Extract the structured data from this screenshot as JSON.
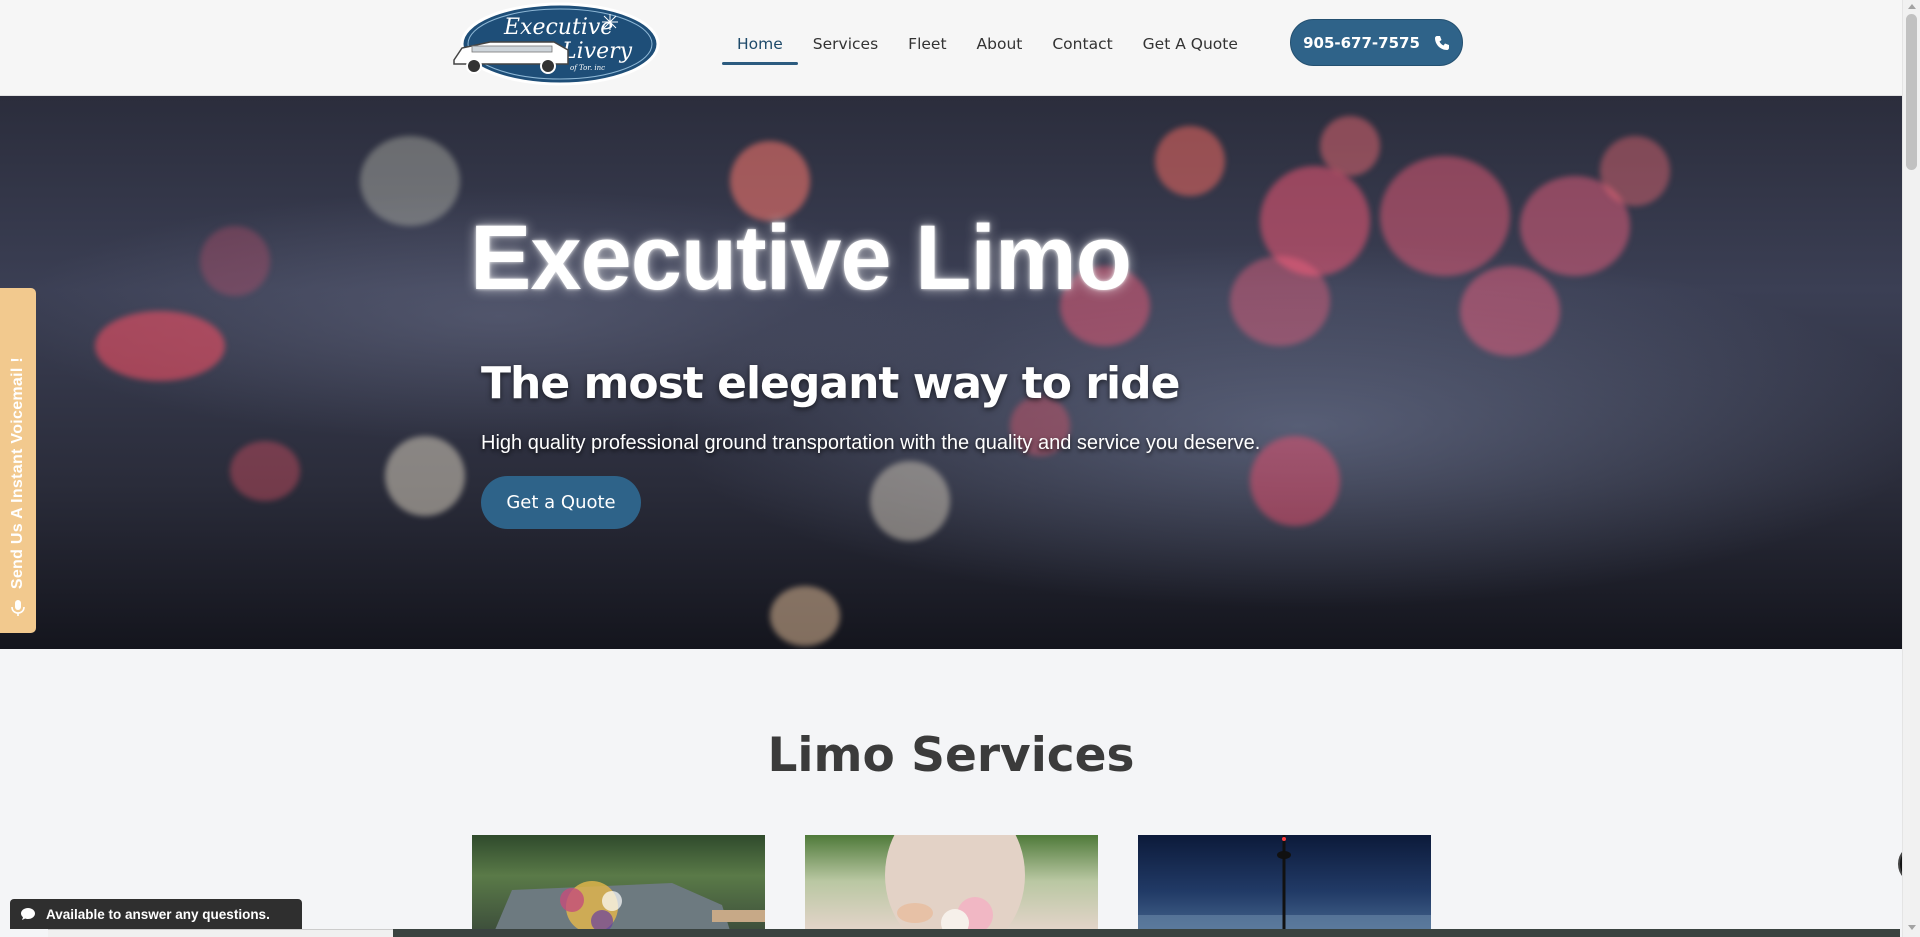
{
  "header": {
    "logo_alt": "Executive Livery",
    "logo_line1": "Executive",
    "logo_line2": "Livery",
    "logo_line3": "of Tor. inc",
    "nav": [
      {
        "label": "Home",
        "active": true
      },
      {
        "label": "Services",
        "active": false
      },
      {
        "label": "Fleet",
        "active": false
      },
      {
        "label": "About",
        "active": false
      },
      {
        "label": "Contact",
        "active": false
      },
      {
        "label": "Get A Quote",
        "active": false
      }
    ],
    "phone": "905-677-7575",
    "phone_icon": "phone-icon"
  },
  "hero": {
    "title": "Executive Limo",
    "subtitle": "The most elegant way to ride",
    "description": "High quality professional ground transportation with the quality and service you deserve.",
    "cta_label": "Get a Quote"
  },
  "voicemail": {
    "label": "Send Us A Instant Voicemail !",
    "icon": "microphone-icon"
  },
  "services": {
    "title": "Limo Services",
    "cards": [
      {
        "image": "wedding-car-flowers"
      },
      {
        "image": "bride-holding-bouquet"
      },
      {
        "image": "toronto-skyline-night"
      }
    ]
  },
  "chat": {
    "label": "Available to answer any questions.",
    "icon": "chat-bubble-icon"
  },
  "colors": {
    "brand": "#2f6389",
    "voicemail_tab": "#f2c98e",
    "chat_bg": "#2f2f2f"
  }
}
